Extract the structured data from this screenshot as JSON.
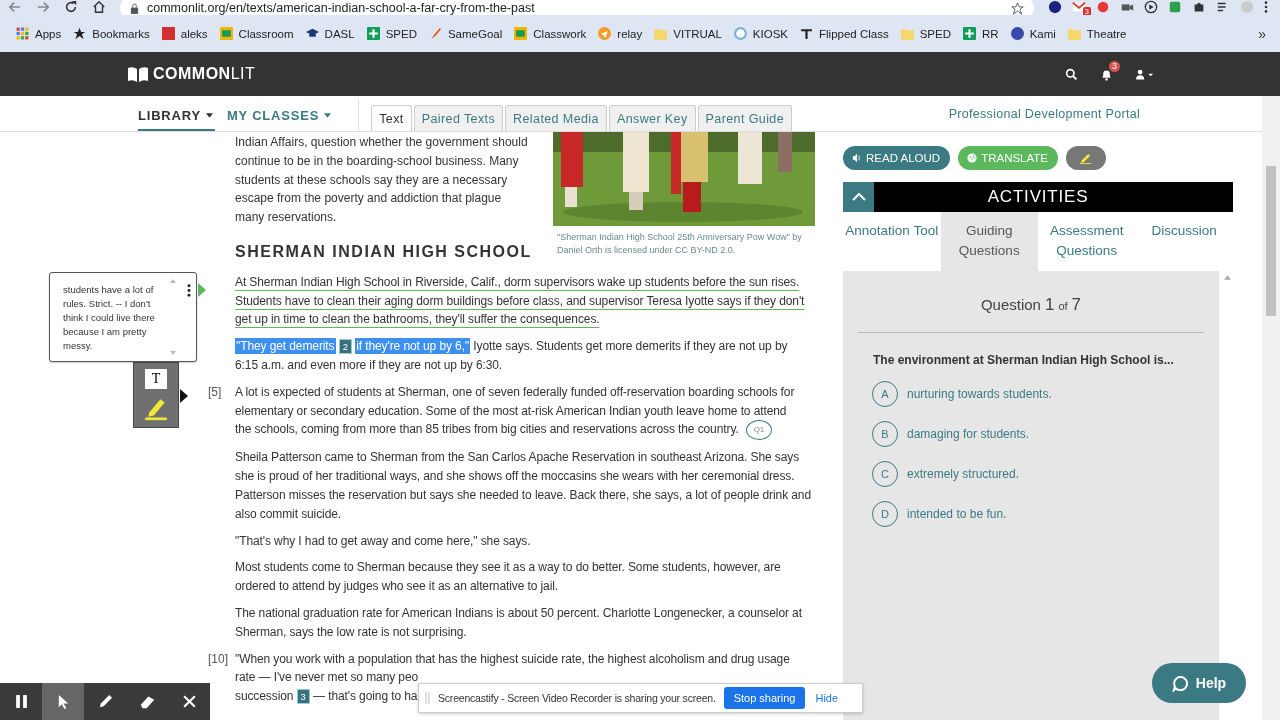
{
  "browser": {
    "url": "commonlit.org/en/texts/american-indian-school-a-far-cry-from-the-past",
    "extensions": [
      {
        "kind": "dot"
      },
      {
        "kind": "mail",
        "badge": "3"
      },
      {
        "kind": "record"
      },
      {
        "kind": "camera"
      },
      {
        "kind": "play"
      },
      {
        "kind": "square"
      },
      {
        "kind": "puzzle"
      },
      {
        "kind": "list"
      },
      {
        "kind": "avatar"
      },
      {
        "kind": "kebab"
      }
    ],
    "bookmarks": [
      {
        "label": "Apps",
        "kind": "grid"
      },
      {
        "label": "Bookmarks",
        "kind": "star"
      },
      {
        "label": "aleks",
        "kind": "logo"
      },
      {
        "label": "Classroom",
        "kind": "board"
      },
      {
        "label": "DASL",
        "kind": "cap"
      },
      {
        "label": "SPED",
        "kind": "plus"
      },
      {
        "label": "SameGoal",
        "kind": "brush"
      },
      {
        "label": "Classwork",
        "kind": "board"
      },
      {
        "label": "relay",
        "kind": "circle"
      },
      {
        "label": "VITRUAL",
        "kind": "folder"
      },
      {
        "label": "KIOSK",
        "kind": "ring"
      },
      {
        "label": "Flipped Class",
        "kind": "pin"
      },
      {
        "label": "SPED",
        "kind": "folder"
      },
      {
        "label": "RR",
        "kind": "plus"
      },
      {
        "label": "Kami",
        "kind": "disc"
      },
      {
        "label": "Theatre",
        "kind": "folder"
      }
    ],
    "more": "»"
  },
  "header": {
    "logo_bold": "COMMON",
    "logo_light": "LIT",
    "notifications": "3"
  },
  "subnav": {
    "menus": [
      {
        "label": "LIBRARY",
        "selected": true
      },
      {
        "label": "MY CLASSES",
        "selected": false
      }
    ],
    "tabs": [
      {
        "label": "Text",
        "selected": true
      },
      {
        "label": "Paired Texts",
        "selected": false
      },
      {
        "label": "Related Media",
        "selected": false
      },
      {
        "label": "Answer Key",
        "selected": false
      },
      {
        "label": "Parent Guide",
        "selected": false
      }
    ],
    "portal_link": "Professional Development Portal"
  },
  "annotation": {
    "note": "students have a lot of rules. Strict. -- I don't think I could live there because I am pretty messy.",
    "text_tool": "T"
  },
  "article": {
    "intro": "Indian Affairs, question whether the government should continue to be in the boarding-school business. Many students at these schools say they are a necessary escape from the poverty and addiction that plague many reservations.",
    "figure": {
      "kind": "picture",
      "caption": "\"Sherman Indian High School 25th Anniversary Pow Wow\" by Daniel Orth is licensed under CC BY-ND 2.0."
    },
    "heading": "SHERMAN INDIAN HIGH SCHOOL",
    "paragraphs": [
      {
        "segments": [
          {
            "kind": "underlined",
            "text": "At Sherman Indian High School in Riverside, Calif., dorm supervisors wake up students before the sun rises. Students have to clean their aging dorm buildings before class, and supervisor Teresa Iyotte says if they don't get up in time to clean the bathrooms, they'll suffer the consequences."
          }
        ]
      },
      {
        "lines": [
          [
            {
              "kind": "highlighted",
              "text": "\"They get demerits"
            },
            {
              "kind": "note",
              "text": "2"
            },
            {
              "kind": "highlighted",
              "text": "if they're not up by 6,\""
            },
            {
              "kind": "plain",
              "text": "Iyotte says. Students get more demerits if they are not up by"
            }
          ],
          [
            {
              "kind": "plain",
              "text": "6:15 a.m. and even more if they are not up by 6:30."
            }
          ]
        ]
      },
      {
        "number": "[5]",
        "lines": [
          [
            {
              "kind": "plain",
              "text": "A lot is expected of students at Sherman, one of seven federally funded off-reservation boarding schools for"
            }
          ],
          [
            {
              "kind": "plain",
              "text": "elementary or secondary education. Some of the most at-risk American Indian youth leave home to attend"
            }
          ],
          [
            {
              "kind": "plain",
              "text": "the schools, coming from more than 85 tribes from big cities and reservations across the country."
            },
            {
              "kind": "question",
              "text": "Q1"
            }
          ]
        ]
      },
      {
        "segments": [
          {
            "kind": "plain",
            "text": "Sheila Patterson came to Sherman from the San Carlos Apache Reservation in southeast Arizona. She says she is proud of her traditional ways, and she shows off the moccasins she wears with her ceremonial dress. Patterson misses the reservation but says she needed to leave. Back there, she says, a lot of people drink and also commit suicide."
          }
        ]
      },
      {
        "segments": [
          {
            "kind": "plain",
            "text": "\"That's why I had to get away and come here,\" she says."
          }
        ]
      },
      {
        "segments": [
          {
            "kind": "plain",
            "text": "Most students come to Sherman because they see it as a way to do better. Some students, however, are ordered to attend by judges who see it as an alternative to jail."
          }
        ]
      },
      {
        "segments": [
          {
            "kind": "plain",
            "text": "The national graduation rate for American Indians is about 50 percent. Charlotte Longenecker, a counselor at Sherman, says the low rate is not surprising."
          }
        ]
      },
      {
        "number": "[10]",
        "lines": [
          [
            {
              "kind": "plain",
              "text": "\"When you work with a population that has the highest suicide rate, the highest alcoholism and drug usage"
            }
          ],
          [
            {
              "kind": "plain",
              "text": "rate — I've never met so many peo"
            }
          ],
          [
            {
              "kind": "plain",
              "text": "succession"
            },
            {
              "kind": "note",
              "text": "3"
            },
            {
              "kind": "plain",
              "text": "— that's going to ha"
            }
          ]
        ]
      }
    ]
  },
  "sidebar": {
    "buttons": [
      {
        "kind": "read",
        "label": "READ ALOUD"
      },
      {
        "kind": "translate",
        "label": "TRANSLATE"
      },
      {
        "kind": "highlight"
      }
    ],
    "title": "ACTIVITIES",
    "expanded": true,
    "tabs": [
      {
        "label": "Annotation Tool",
        "selected": false
      },
      {
        "label": "Guiding Questions",
        "selected": true
      },
      {
        "label": "Assessment Questions",
        "selected": false
      },
      {
        "label": "Discussion",
        "selected": false
      }
    ],
    "question": {
      "label": "Question",
      "current": "1",
      "of": "of",
      "total": "7",
      "prompt": "The environment at Sherman Indian High School is...",
      "options": [
        {
          "letter": "A",
          "text": "nurturing towards students.",
          "selected": false
        },
        {
          "letter": "B",
          "text": "damaging for students.",
          "selected": false
        },
        {
          "letter": "C",
          "text": "extremely structured.",
          "selected": false
        },
        {
          "letter": "D",
          "text": "intended to be fun.",
          "selected": false
        }
      ]
    }
  },
  "recorder": {
    "tools": [
      {
        "kind": "pause",
        "selected": false
      },
      {
        "kind": "pointer",
        "selected": true
      },
      {
        "kind": "pen",
        "selected": false
      },
      {
        "kind": "eraser",
        "selected": false
      },
      {
        "kind": "close",
        "selected": false
      }
    ]
  },
  "sharing_bar": {
    "message": "Screencastify - Screen Video Recorder is sharing your screen.",
    "stop": "Stop sharing",
    "hide": "Hide"
  },
  "help": "Help"
}
